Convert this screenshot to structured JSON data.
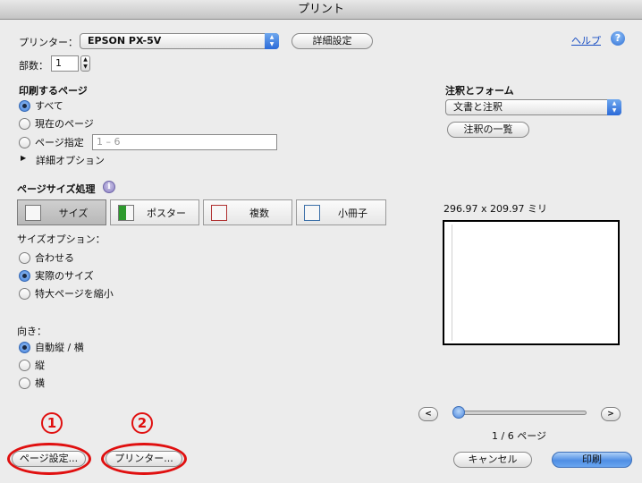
{
  "window": {
    "title": "プリント"
  },
  "printer": {
    "label": "プリンター：",
    "value": "EPSON PX-5V",
    "details_button": "詳細設定"
  },
  "help": {
    "link": "ヘルプ",
    "icon": "?"
  },
  "copies": {
    "label": "部数：",
    "value": "1"
  },
  "pages": {
    "heading": "印刷するページ",
    "options": [
      "すべて",
      "現在のページ",
      "ページ指定"
    ],
    "selected": 0,
    "range_placeholder": "1 – 6",
    "advanced": "詳細オプション"
  },
  "annotations": {
    "heading": "注釈とフォーム",
    "value": "文書と注釈",
    "summary_button": "注釈の一覧"
  },
  "page_size": {
    "heading": "ページサイズ処理",
    "info_icon": "i",
    "modes": [
      "サイズ",
      "ポスター",
      "複数",
      "小冊子"
    ],
    "selected_mode": 0,
    "size_options_label": "サイズオプション：",
    "size_options": [
      "合わせる",
      "実際のサイズ",
      "特大ページを縮小"
    ],
    "selected_size": 1
  },
  "preview": {
    "dimensions": "296.97 x 209.97 ミリ",
    "prev": "<",
    "next": ">",
    "page_indicator": "1 / 6 ページ",
    "slider_position": 0
  },
  "orientation": {
    "label": "向き：",
    "options": [
      "自動縦 / 横",
      "縦",
      "横"
    ],
    "selected": 0
  },
  "bottom": {
    "page_setup": "ページ設定...",
    "printer": "プリンター...",
    "cancel": "キャンセル",
    "print": "印刷"
  },
  "markers": {
    "one": "1",
    "two": "2",
    "color": "#e01010"
  }
}
